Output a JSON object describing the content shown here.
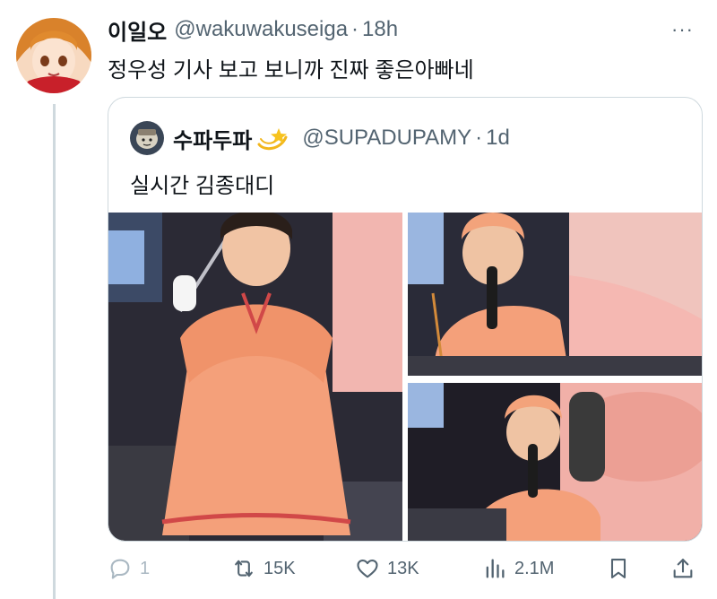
{
  "tweet": {
    "display_name": "이일오",
    "handle": "@wakuwakuseiga",
    "separator": "·",
    "time": "18h",
    "more_label": "···",
    "text": "정우성 기사 보고 보니까 진짜 좋은아빠네",
    "avatar_icon": "anime-girl-avatar-icon"
  },
  "quote": {
    "display_name": "수파두파",
    "emoji_icon": "dizzy-star-emoji-icon",
    "handle": "@SUPADUPAMY",
    "separator": "·",
    "time": "1d",
    "text": "실시간 김종대디",
    "images": [
      {
        "alt": "performer in peach costume holding wand"
      },
      {
        "alt": "performer singing with microphone"
      },
      {
        "alt": "performer singing close-up"
      }
    ]
  },
  "actions": {
    "reply_count": "1",
    "retweet_count": "15K",
    "like_count": "13K",
    "views_count": "2.1M"
  },
  "colors": {
    "text_primary": "#0f1419",
    "text_secondary": "#536471",
    "border": "#cfd9de",
    "costume_peach": "#f4a07a"
  }
}
